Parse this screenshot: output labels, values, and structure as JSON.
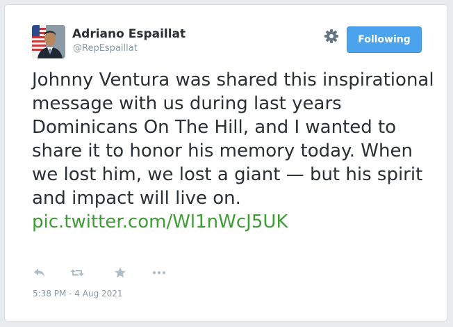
{
  "user": {
    "name": "Adriano Espaillat",
    "handle": "@RepEspaillat",
    "avatar_icon": "profile-photo-avatar"
  },
  "header": {
    "settings_icon": "gear-icon",
    "follow_label": "Following"
  },
  "tweet": {
    "text": "Johnny Ventura was shared this inspirational message with us during last years Dominicans On The Hill, and I wanted to share it to honor his memory today. When we lost him, we lost a giant — but his spirit and impact will live on.",
    "link_text": "pic.twitter.com/Wl1nWcJ5UK",
    "timestamp": "5:38 PM - 4 Aug 2021"
  },
  "actions": [
    {
      "icon": "reply-icon"
    },
    {
      "icon": "retweet-icon"
    },
    {
      "icon": "favorite-star-icon"
    },
    {
      "icon": "more-icon"
    }
  ],
  "colors": {
    "accent": "#4ba2ed",
    "link": "#3e9c35",
    "text": "#292f33",
    "muted": "#8899a6",
    "icon": "#b0bdc6"
  }
}
